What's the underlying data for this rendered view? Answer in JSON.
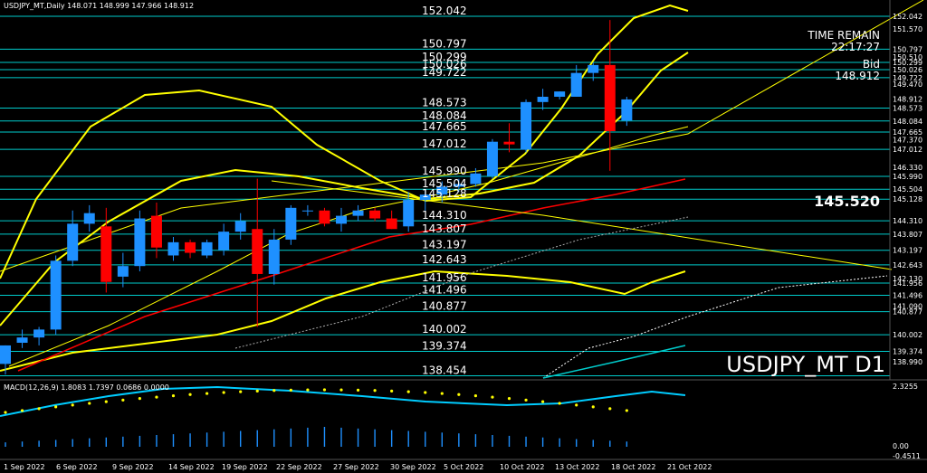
{
  "header": {
    "symbol_info": "USDJPY_MT,Daily  148.071 148.999 147.966 148.912"
  },
  "info_panel": {
    "time_remain_label": "TIME REMAIN",
    "time_remain_value": "22:17:27",
    "bid_label": "Bid",
    "bid_value": "148.912",
    "highlight_price": "145.520",
    "watermark": "USDJPY_MT D1"
  },
  "macd": {
    "label": "MACD(12,26,9) 1.8083 1.7397 0.0686 0.0000",
    "axis_top": "2.3255",
    "axis_zero": "0.00",
    "axis_bottom": "-0.4511",
    "line_color": "#00ccff",
    "signal_color": "#ffff00",
    "hist_color": "#1e90ff"
  },
  "colors": {
    "up_candle": "#1e90ff",
    "down_candle": "#ff0000",
    "level_line": "#00cccc",
    "bollinger": "#ffff00",
    "ma_red": "#ff0000",
    "ichimoku_cloud": "#ffffff"
  },
  "chart_data": {
    "type": "candlestick",
    "title": "USDJPY_MT,Daily",
    "ylim": [
      138.0,
      152.3
    ],
    "x_tick_labels": [
      "1 Sep 2022",
      "6 Sep 2022",
      "9 Sep 2022",
      "14 Sep 2022",
      "19 Sep 2022",
      "22 Sep 2022",
      "27 Sep 2022",
      "30 Sep 2022",
      "5 Oct 2022",
      "10 Oct 2022",
      "13 Oct 2022",
      "18 Oct 2022",
      "21 Oct 2022"
    ],
    "right_axis_labels": [
      "152.042",
      "151.570",
      "150.797",
      "150.510",
      "150.299",
      "150.026",
      "149.722",
      "149.470",
      "148.912",
      "148.573",
      "148.084",
      "147.665",
      "147.370",
      "147.012",
      "146.330",
      "145.990",
      "145.504",
      "145.128",
      "144.310",
      "143.807",
      "143.197",
      "142.643",
      "142.130",
      "141.956",
      "141.496",
      "141.090",
      "140.877",
      "140.002",
      "139.374",
      "138.990"
    ],
    "levels": [
      "152.042",
      "150.797",
      "150.299",
      "150.026",
      "149.722",
      "148.573",
      "148.084",
      "147.665",
      "147.012",
      "145.990",
      "145.504",
      "145.128",
      "144.310",
      "143.807",
      "143.197",
      "142.643",
      "141.956",
      "141.496",
      "140.877",
      "140.002",
      "139.374",
      "138.454"
    ],
    "candles": [
      {
        "o": 138.9,
        "h": 139.6,
        "l": 138.5,
        "c": 139.6
      },
      {
        "o": 139.7,
        "h": 140.2,
        "l": 139.5,
        "c": 139.9
      },
      {
        "o": 139.9,
        "h": 140.3,
        "l": 139.6,
        "c": 140.2
      },
      {
        "o": 140.2,
        "h": 143.0,
        "l": 140.0,
        "c": 142.8
      },
      {
        "o": 142.8,
        "h": 144.7,
        "l": 142.6,
        "c": 144.2
      },
      {
        "o": 144.2,
        "h": 144.9,
        "l": 143.9,
        "c": 144.6
      },
      {
        "o": 144.1,
        "h": 144.8,
        "l": 141.6,
        "c": 142.0
      },
      {
        "o": 142.2,
        "h": 143.1,
        "l": 141.8,
        "c": 142.6
      },
      {
        "o": 142.6,
        "h": 144.7,
        "l": 142.4,
        "c": 144.4
      },
      {
        "o": 144.5,
        "h": 145.0,
        "l": 142.9,
        "c": 143.3
      },
      {
        "o": 143.0,
        "h": 143.7,
        "l": 142.8,
        "c": 143.5
      },
      {
        "o": 143.5,
        "h": 143.6,
        "l": 142.9,
        "c": 143.1
      },
      {
        "o": 143.0,
        "h": 143.6,
        "l": 142.9,
        "c": 143.5
      },
      {
        "o": 143.2,
        "h": 144.2,
        "l": 143.0,
        "c": 143.9
      },
      {
        "o": 143.9,
        "h": 144.6,
        "l": 143.6,
        "c": 144.3
      },
      {
        "o": 144.0,
        "h": 145.9,
        "l": 140.3,
        "c": 142.3
      },
      {
        "o": 142.3,
        "h": 144.0,
        "l": 141.9,
        "c": 143.6
      },
      {
        "o": 143.6,
        "h": 144.9,
        "l": 143.4,
        "c": 144.8
      },
      {
        "o": 144.7,
        "h": 144.9,
        "l": 144.5,
        "c": 144.7
      },
      {
        "o": 144.7,
        "h": 144.8,
        "l": 144.1,
        "c": 144.2
      },
      {
        "o": 144.2,
        "h": 144.8,
        "l": 143.9,
        "c": 144.5
      },
      {
        "o": 144.5,
        "h": 144.9,
        "l": 144.3,
        "c": 144.7
      },
      {
        "o": 144.7,
        "h": 144.8,
        "l": 144.3,
        "c": 144.4
      },
      {
        "o": 144.4,
        "h": 144.7,
        "l": 144.0,
        "c": 144.0
      },
      {
        "o": 144.1,
        "h": 145.4,
        "l": 143.9,
        "c": 145.1
      },
      {
        "o": 145.1,
        "h": 145.5,
        "l": 144.7,
        "c": 145.3
      },
      {
        "o": 145.3,
        "h": 145.8,
        "l": 145.0,
        "c": 145.6
      },
      {
        "o": 145.6,
        "h": 145.9,
        "l": 145.4,
        "c": 145.7
      },
      {
        "o": 145.7,
        "h": 146.3,
        "l": 145.6,
        "c": 146.1
      },
      {
        "o": 146.0,
        "h": 147.4,
        "l": 145.9,
        "c": 147.3
      },
      {
        "o": 147.3,
        "h": 148.0,
        "l": 146.9,
        "c": 147.2
      },
      {
        "o": 147.0,
        "h": 148.9,
        "l": 146.9,
        "c": 148.8
      },
      {
        "o": 148.8,
        "h": 149.3,
        "l": 148.5,
        "c": 149.0
      },
      {
        "o": 149.0,
        "h": 149.2,
        "l": 148.9,
        "c": 149.2
      },
      {
        "o": 149.0,
        "h": 150.2,
        "l": 149.0,
        "c": 149.9
      },
      {
        "o": 149.9,
        "h": 150.3,
        "l": 149.6,
        "c": 150.2
      },
      {
        "o": 150.2,
        "h": 151.9,
        "l": 146.2,
        "c": 147.7
      },
      {
        "o": 148.1,
        "h": 149.0,
        "l": 147.9,
        "c": 148.9
      }
    ]
  }
}
